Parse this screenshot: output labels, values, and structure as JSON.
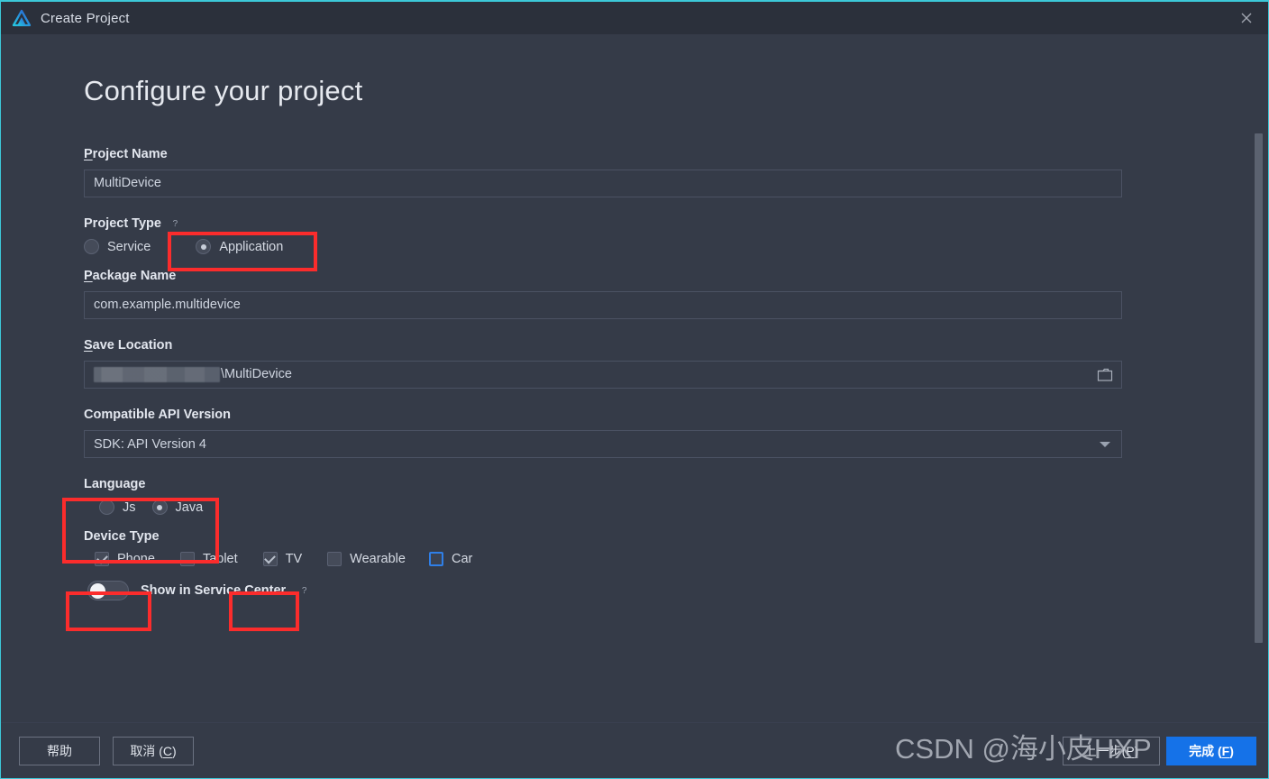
{
  "window": {
    "title": "Create Project",
    "logo_icon": "deveco-triangle-logo",
    "close_icon": "close-icon"
  },
  "page": {
    "heading": "Configure your project"
  },
  "fields": {
    "project_name": {
      "label": "Project Name",
      "mnemonic": "P",
      "value": "MultiDevice"
    },
    "project_type": {
      "label": "Project Type",
      "help_icon": "question-mark-icon",
      "options": [
        {
          "label": "Service",
          "selected": false
        },
        {
          "label": "Application",
          "selected": true
        }
      ]
    },
    "package_name": {
      "label": "Package Name",
      "mnemonic": "P",
      "value": "com.example.multidevice"
    },
    "save_location": {
      "label": "Save Location",
      "mnemonic": "S",
      "redacted_prefix": true,
      "value": "\\MultiDevice",
      "browse_icon": "folder-icon"
    },
    "compatible_api_version": {
      "label": "Compatible API Version",
      "value": "SDK: API Version 4",
      "caret_icon": "chevron-down-icon"
    },
    "language": {
      "label": "Language",
      "options": [
        {
          "label": "Js",
          "selected": false
        },
        {
          "label": "Java",
          "selected": true
        }
      ]
    },
    "device_type": {
      "label": "Device Type",
      "options": [
        {
          "label": "Phone",
          "checked": true,
          "focused": false
        },
        {
          "label": "Tablet",
          "checked": false,
          "focused": false
        },
        {
          "label": "TV",
          "checked": true,
          "focused": false
        },
        {
          "label": "Wearable",
          "checked": false,
          "focused": false
        },
        {
          "label": "Car",
          "checked": false,
          "focused": true
        }
      ]
    },
    "show_in_service_center": {
      "label": "Show in Service Center",
      "enabled": false,
      "help_icon": "question-mark-icon"
    }
  },
  "footer": {
    "help": "帮助",
    "cancel": "取消 (C)",
    "cancel_mnemonic": "C",
    "previous": "上一步(P)",
    "previous_mnemonic": "P",
    "finish": "完成 (F)",
    "finish_mnemonic": "F"
  },
  "watermark": {
    "text": "CSDN @海小皮HXP"
  },
  "colors": {
    "accent_top_border": "#3cc8d8",
    "primary_button": "#1572e8",
    "annotation": "#fb2c2c",
    "focus_border": "#2f7fe8",
    "window_background": "#353b48",
    "titlebar_background": "#2b303b"
  }
}
